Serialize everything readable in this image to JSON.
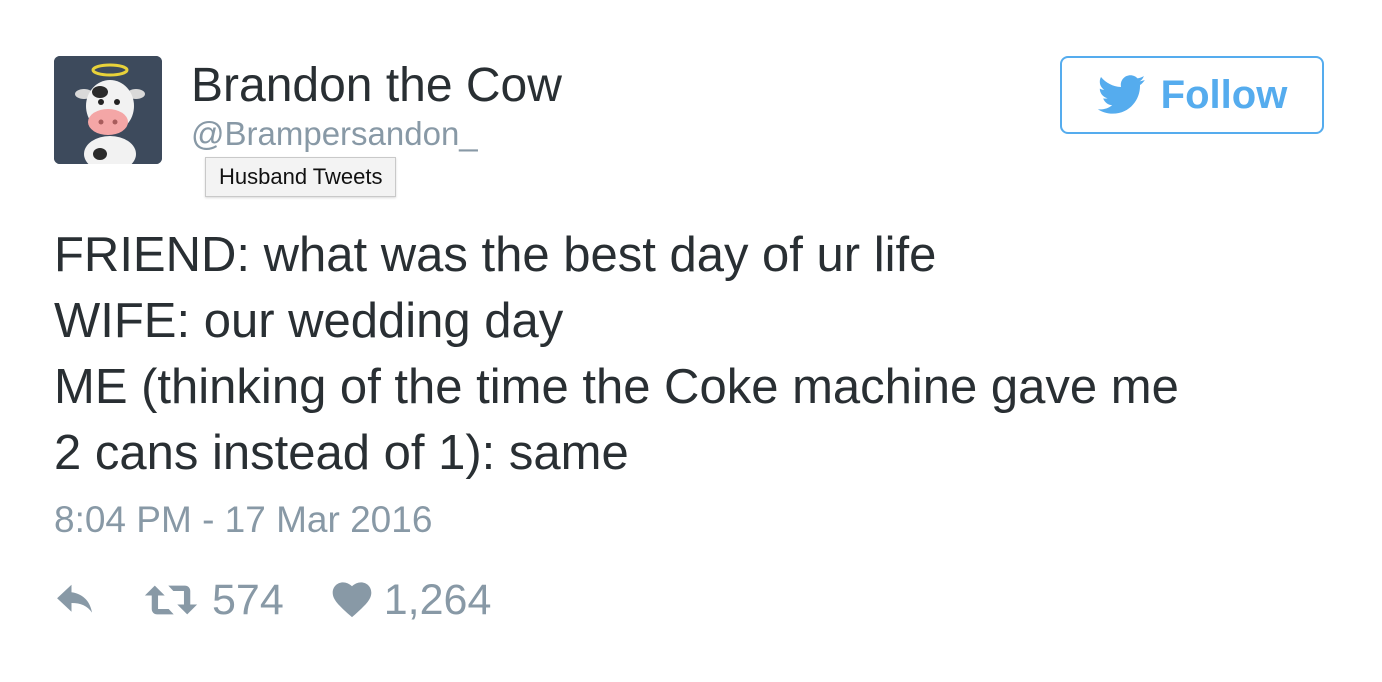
{
  "user": {
    "display_name": "Brandon the Cow",
    "handle": "@Brampersandon_",
    "avatar_icon": "cow-with-halo-avatar"
  },
  "tooltip": {
    "text": "Husband Tweets"
  },
  "follow_button": {
    "label": "Follow",
    "icon": "twitter-bird-icon"
  },
  "tweet": {
    "lines": [
      "FRIEND: what was the best day of ur life",
      "WIFE: our wedding day",
      "ME (thinking of the time the Coke machine gave me",
      "2 cans instead of 1): same"
    ],
    "timestamp": "8:04 PM - 17 Mar 2016"
  },
  "actions": {
    "reply_icon": "reply-icon",
    "retweet_icon": "retweet-icon",
    "retweet_count": "574",
    "like_icon": "heart-icon",
    "like_count": "1,264"
  },
  "colors": {
    "accent": "#55acee",
    "text": "#292f33",
    "muted": "#8899a6"
  }
}
